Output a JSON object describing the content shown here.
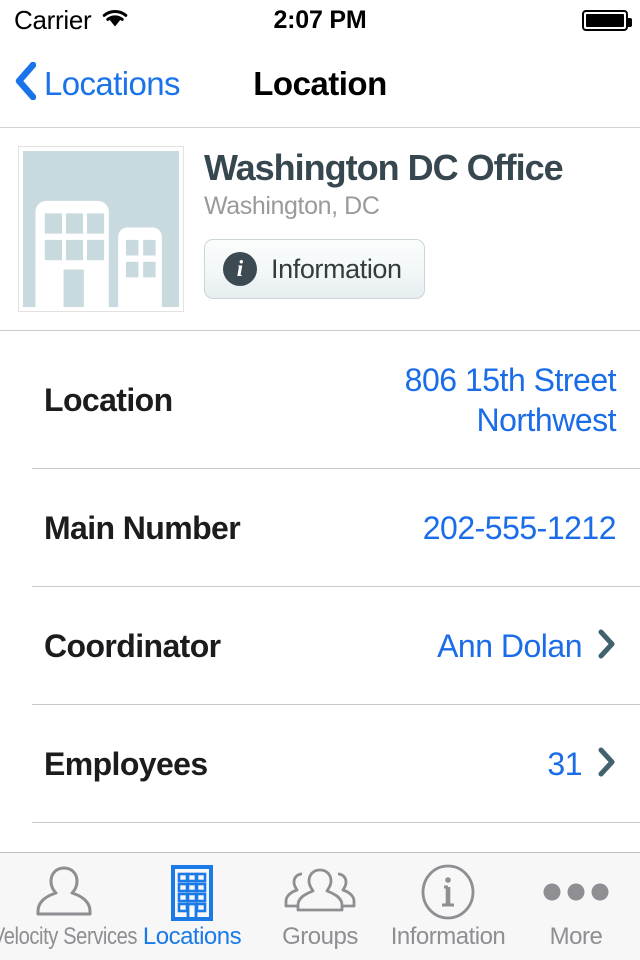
{
  "status_bar": {
    "carrier": "Carrier",
    "wifi_icon": "wifi-icon",
    "time": "2:07 PM",
    "battery_icon": "battery-full-icon"
  },
  "nav_bar": {
    "back_icon": "chevron-left-icon",
    "back_label": "Locations",
    "title": "Location"
  },
  "header": {
    "thumbnail_icon": "building-placeholder-icon",
    "title": "Washington DC Office",
    "subtitle": "Washington, DC",
    "info_button": {
      "icon": "info-circle-icon",
      "label": "Information"
    }
  },
  "details": {
    "rows": [
      {
        "label": "Location",
        "value": "806 15th Street Northwest",
        "chevron": false
      },
      {
        "label": "Main Number",
        "value": "202-555-1212",
        "chevron": false
      },
      {
        "label": "Coordinator",
        "value": "Ann Dolan",
        "chevron": true
      },
      {
        "label": "Employees",
        "value": "31",
        "chevron": true
      }
    ]
  },
  "tab_bar": {
    "items": [
      {
        "label": "Velocity Services",
        "icon": "person-icon",
        "active": false
      },
      {
        "label": "Locations",
        "icon": "building-icon",
        "active": true
      },
      {
        "label": "Groups",
        "icon": "people-group-icon",
        "active": false
      },
      {
        "label": "Information",
        "icon": "info-circle-outline-icon",
        "active": false
      },
      {
        "label": "More",
        "icon": "ellipsis-icon",
        "active": false
      }
    ]
  },
  "colors": {
    "accent_blue": "#1a6ce8",
    "tab_active_blue": "#1a7ae8",
    "title_slate": "#37474f",
    "subtitle_gray": "#9a9a9a",
    "separator": "#c8c7cc",
    "tabbar_bg": "#f7f7f7",
    "thumb_fill": "#c9dade"
  }
}
